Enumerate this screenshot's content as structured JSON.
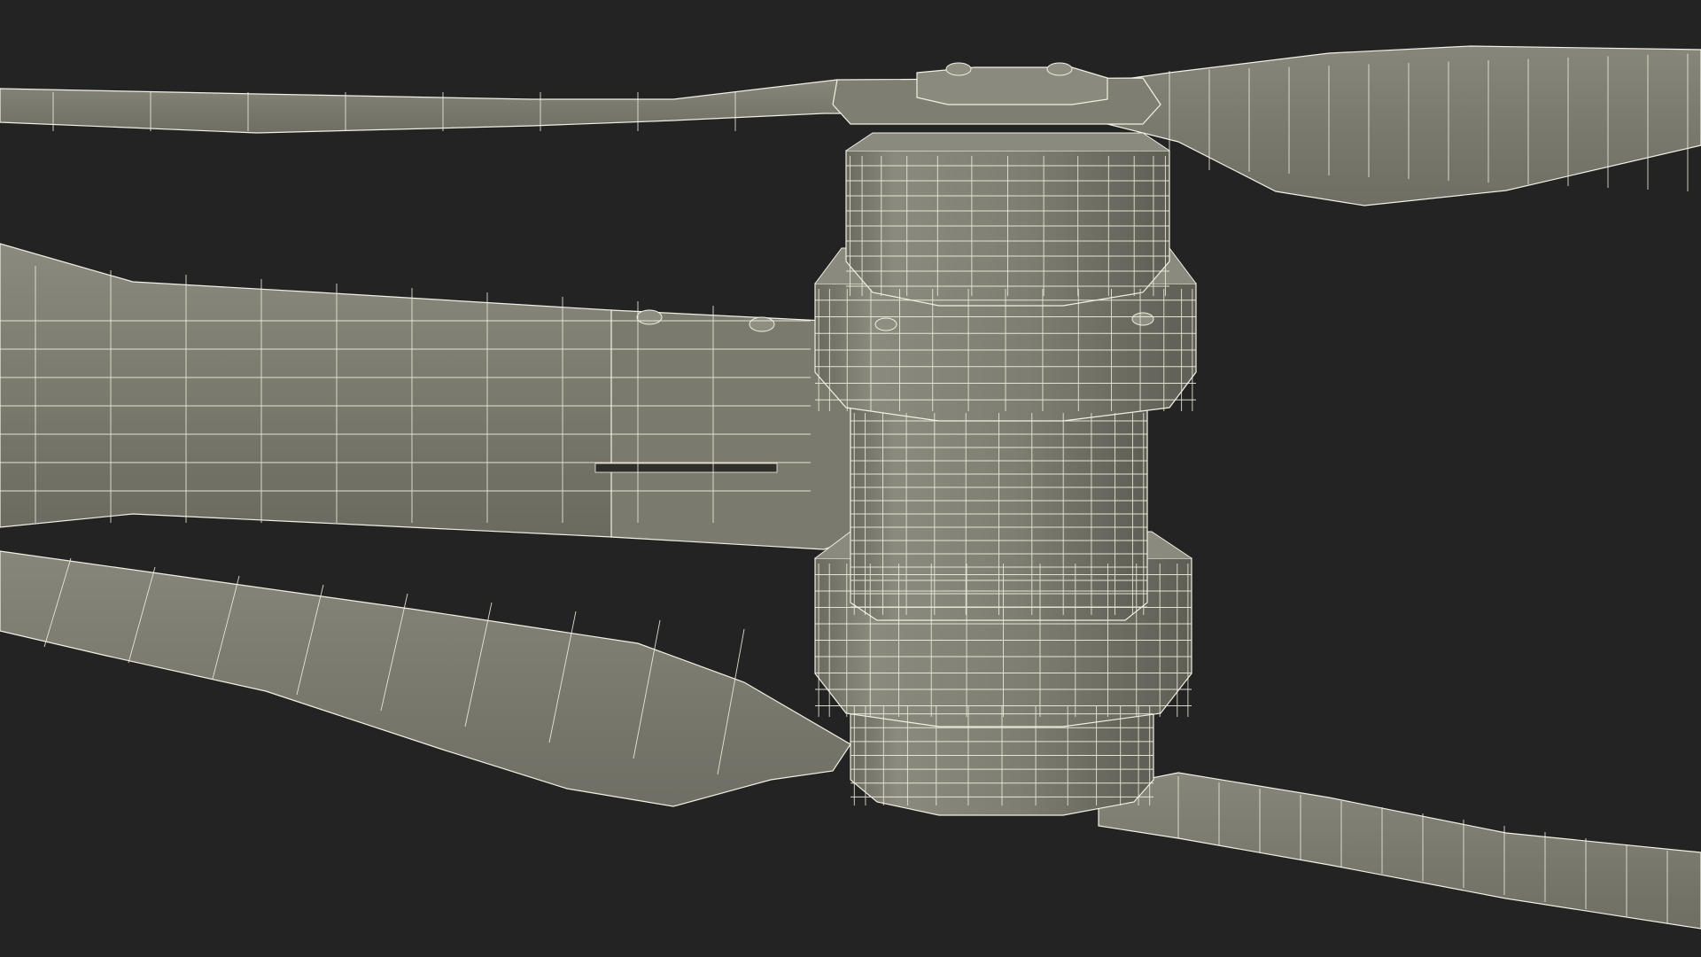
{
  "scene": {
    "subject": "wireframe-render",
    "background_color": "#232323",
    "surface_color": "#7c7c70",
    "surface_shade_color": "#5f5f55",
    "surface_light_color": "#8e8e80",
    "wire_color": "#f2f0e2",
    "edge_color": "#3a3a34"
  }
}
